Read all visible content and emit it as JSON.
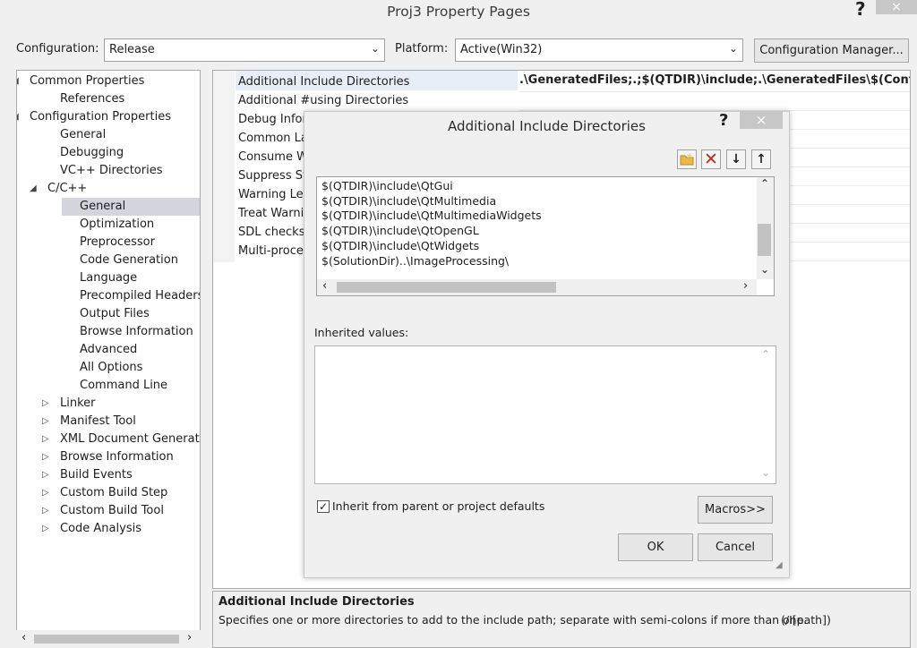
{
  "window": {
    "title": "Proj3 Property Pages",
    "help": "?",
    "close": "×"
  },
  "toolbar": {
    "configuration_label": "Configuration:",
    "configuration_value": "Release",
    "platform_label": "Platform:",
    "platform_value": "Active(Win32)",
    "config_manager_label": "Configuration Manager..."
  },
  "tree": {
    "items": [
      {
        "label": "Common Properties",
        "expander": "◢"
      },
      {
        "label": "References"
      },
      {
        "label": "Configuration Properties",
        "expander": "◢"
      },
      {
        "label": "General"
      },
      {
        "label": "Debugging"
      },
      {
        "label": "VC++ Directories"
      },
      {
        "label": "C/C++",
        "expander": "◢"
      },
      {
        "label": "General"
      },
      {
        "label": "Optimization"
      },
      {
        "label": "Preprocessor"
      },
      {
        "label": "Code Generation"
      },
      {
        "label": "Language"
      },
      {
        "label": "Precompiled Headers"
      },
      {
        "label": "Output Files"
      },
      {
        "label": "Browse Information"
      },
      {
        "label": "Advanced"
      },
      {
        "label": "All Options"
      },
      {
        "label": "Command Line"
      },
      {
        "label": "Linker",
        "expander": "▷"
      },
      {
        "label": "Manifest Tool",
        "expander": "▷"
      },
      {
        "label": "XML Document Generator",
        "expander": "▷"
      },
      {
        "label": "Browse Information",
        "expander": "▷"
      },
      {
        "label": "Build Events",
        "expander": "▷"
      },
      {
        "label": "Custom Build Step",
        "expander": "▷"
      },
      {
        "label": "Custom Build Tool",
        "expander": "▷"
      },
      {
        "label": "Code Analysis",
        "expander": "▷"
      }
    ]
  },
  "grid": {
    "rows": [
      {
        "name": "Additional Include Directories",
        "value": ".\\GeneratedFiles;.;$(QTDIR)\\include;.\\GeneratedFiles\\$(ConfigurationN"
      },
      {
        "name": "Additional #using Directories"
      },
      {
        "name": "Debug Infor"
      },
      {
        "name": "Common La"
      },
      {
        "name": "Consume W"
      },
      {
        "name": "Suppress Sta"
      },
      {
        "name": "Warning Lev"
      },
      {
        "name": "Treat Warnir"
      },
      {
        "name": "SDL checks"
      },
      {
        "name": "Multi-proces"
      }
    ]
  },
  "description": {
    "title": "Additional Include Directories",
    "text": "Specifies one or more directories to add to the include path; separate with semi-colons if more than one.",
    "switch": "(/I[path])"
  },
  "dialog": {
    "title": "Additional Include Directories",
    "help": "?",
    "close": "×",
    "directories": [
      "$(QTDIR)\\include\\QtGui",
      "$(QTDIR)\\include\\QtMultimedia",
      "$(QTDIR)\\include\\QtMultimediaWidgets",
      "$(QTDIR)\\include\\QtOpenGL",
      "$(QTDIR)\\include\\QtWidgets",
      "$(SolutionDir)..\\ImageProcessing\\"
    ],
    "inherited_label": "Inherited values:",
    "inherit_checkbox_label": "Inherit from parent or project defaults",
    "inherit_checked": true,
    "macros_label": "Macros>>",
    "ok_label": "OK",
    "cancel_label": "Cancel"
  },
  "colors": {
    "selection": "#d4d4dc",
    "delete_icon": "#c42b1c",
    "folder_icon": "#e8b84a"
  }
}
